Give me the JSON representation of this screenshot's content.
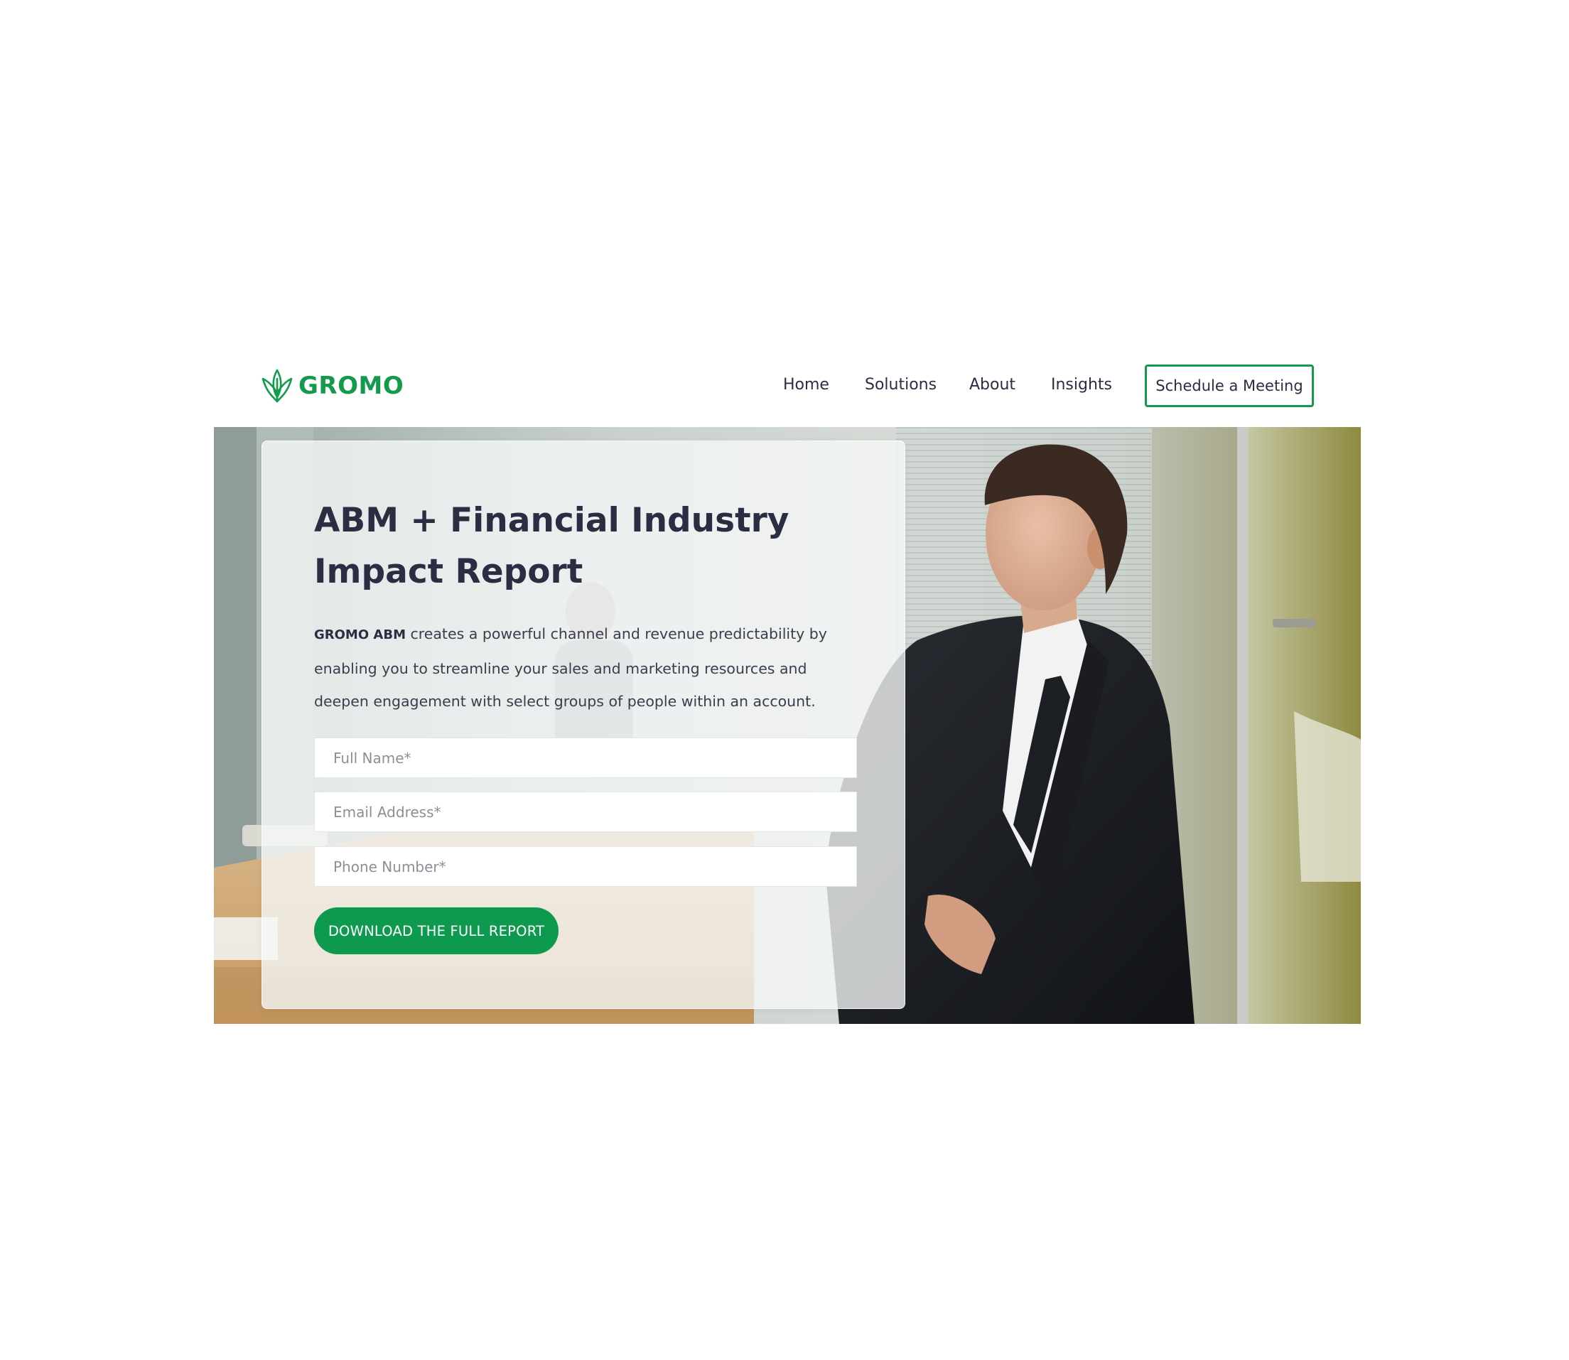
{
  "header": {
    "logo_text": "GROMO",
    "nav": [
      {
        "label": "Home"
      },
      {
        "label": "Solutions"
      },
      {
        "label": "About"
      },
      {
        "label": "Insights"
      }
    ],
    "cta_label": "Schedule a Meeting"
  },
  "hero": {
    "title": "ABM + Financial Industry Impact Report",
    "description_brand": "GROMO ABM",
    "description_text": " creates a powerful channel and revenue predictability by enabling you to streamline your sales and marketing resources and deepen engagement with select groups of people within an account.",
    "form": {
      "full_name_placeholder": "Full Name*",
      "email_placeholder": "Email Address*",
      "phone_placeholder": "Phone Number*",
      "submit_label": "DOWNLOAD THE FULL REPORT"
    }
  },
  "colors": {
    "brand_green": "#149a4d",
    "button_green": "#0e9a4e",
    "text_dark": "#2b2d42"
  },
  "icons": {
    "logo": "leaf-logo-icon"
  }
}
